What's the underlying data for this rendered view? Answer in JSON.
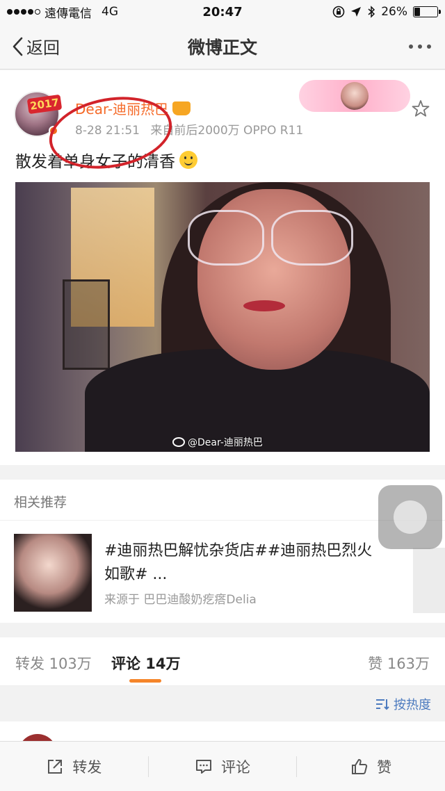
{
  "status_bar": {
    "carrier": "遠傳電信",
    "network": "4G",
    "time": "20:47",
    "battery": "26%",
    "battery_level": 0.26
  },
  "nav": {
    "back_label": "返回",
    "title": "微博正文"
  },
  "post": {
    "year_badge": "2017",
    "username": "Dear-迪丽热巴",
    "time": "8-28 21:51",
    "source": "来自前后2000万 OPPO R11",
    "text": "散发着单身女子的清香",
    "watermark": "@Dear-迪丽热巴"
  },
  "related": {
    "header": "相关推荐",
    "title": "#迪丽热巴解忧杂货店##迪丽热巴烈火如歌# ...",
    "source": "来源于 巴巴迪酸奶疙瘩Delia"
  },
  "tabs": {
    "repost": "转发 103万",
    "comment": "评论 14万",
    "like": "赞 163万"
  },
  "sort": {
    "label": "按热度"
  },
  "bottom_bar": {
    "repost": "转发",
    "comment": "评论",
    "like": "赞"
  },
  "colors": {
    "accent_orange": "#f5852a",
    "username_orange": "#f56a28",
    "link_blue": "#4d7bbf",
    "annotation_red": "#d2232a"
  }
}
